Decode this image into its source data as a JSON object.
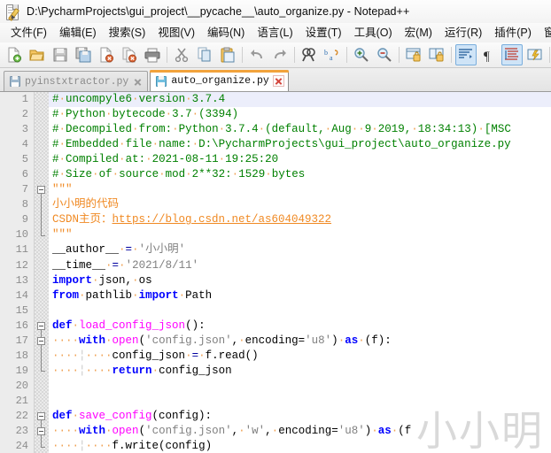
{
  "window": {
    "title": "D:\\PycharmProjects\\gui_project\\__pycache__\\auto_organize.py - Notepad++",
    "app_icon": "notepad-plus-plus-icon"
  },
  "menubar": {
    "items": [
      {
        "label": "文件(F)",
        "name": "menu-file"
      },
      {
        "label": "编辑(E)",
        "name": "menu-edit"
      },
      {
        "label": "搜索(S)",
        "name": "menu-search"
      },
      {
        "label": "视图(V)",
        "name": "menu-view"
      },
      {
        "label": "编码(N)",
        "name": "menu-encoding"
      },
      {
        "label": "语言(L)",
        "name": "menu-language"
      },
      {
        "label": "设置(T)",
        "name": "menu-settings"
      },
      {
        "label": "工具(O)",
        "name": "menu-tools"
      },
      {
        "label": "宏(M)",
        "name": "menu-macro"
      },
      {
        "label": "运行(R)",
        "name": "menu-run"
      },
      {
        "label": "插件(P)",
        "name": "menu-plugins"
      },
      {
        "label": "窗口(W",
        "name": "menu-window"
      }
    ]
  },
  "toolbar": {
    "buttons": [
      {
        "icon": "new-file-icon",
        "active": false
      },
      {
        "icon": "open-file-icon",
        "active": false
      },
      {
        "icon": "save-icon",
        "active": false
      },
      {
        "icon": "save-all-icon",
        "active": false
      },
      {
        "icon": "close-file-icon",
        "active": false
      },
      {
        "icon": "close-all-files-icon",
        "active": false
      },
      {
        "icon": "print-icon",
        "active": false
      },
      {
        "sep": true
      },
      {
        "icon": "cut-icon",
        "active": false
      },
      {
        "icon": "copy-icon",
        "active": false
      },
      {
        "icon": "paste-icon",
        "active": false
      },
      {
        "sep": true
      },
      {
        "icon": "undo-icon",
        "active": false
      },
      {
        "icon": "redo-icon",
        "active": false
      },
      {
        "sep": true
      },
      {
        "icon": "find-icon",
        "active": false
      },
      {
        "icon": "replace-icon",
        "active": false
      },
      {
        "sep": true
      },
      {
        "icon": "zoom-in-icon",
        "active": false
      },
      {
        "icon": "zoom-out-icon",
        "active": false
      },
      {
        "sep": true
      },
      {
        "icon": "sync-vertical-scroll-icon",
        "active": false
      },
      {
        "icon": "sync-horizontal-scroll-icon",
        "active": false
      },
      {
        "sep": true
      },
      {
        "icon": "word-wrap-icon",
        "active": true
      },
      {
        "icon": "show-all-characters-icon",
        "active": false
      },
      {
        "icon": "indent-guide-icon",
        "active": true
      },
      {
        "icon": "user-defined-language-icon",
        "active": false
      },
      {
        "sep2": true
      },
      {
        "icon": "document-map-icon",
        "active": false
      },
      {
        "icon": "function-list-icon",
        "active": false
      },
      {
        "icon": "folder-as-workspace-icon",
        "active": false
      }
    ]
  },
  "tabs": [
    {
      "label": "pyinstxtractor.py",
      "active": false,
      "name": "tab-pyinstxtractor"
    },
    {
      "label": "auto_organize.py",
      "active": true,
      "name": "tab-auto-organize"
    }
  ],
  "editor": {
    "current_line": 1,
    "watermark": "小小明",
    "line_numbers": [
      1,
      2,
      3,
      4,
      5,
      6,
      7,
      8,
      9,
      10,
      11,
      12,
      13,
      14,
      15,
      16,
      17,
      18,
      19,
      20,
      21,
      22,
      23,
      24
    ],
    "lines": [
      {
        "n": 1,
        "tokens": [
          {
            "t": "# uncompyle6 version 3.7.4",
            "c": "c-com",
            "dots": true
          }
        ]
      },
      {
        "n": 2,
        "tokens": [
          {
            "t": "# Python bytecode 3.7 (3394)",
            "c": "c-com",
            "dots": true
          }
        ]
      },
      {
        "n": 3,
        "tokens": [
          {
            "t": "# Decompiled from: Python 3.7.4 (default, Aug  9 2019, 18:34:13) [MSC",
            "c": "c-com",
            "dots": true
          }
        ]
      },
      {
        "n": 4,
        "tokens": [
          {
            "t": "# Embedded file name: D:\\PycharmProjects\\gui_project\\auto_organize.py",
            "c": "c-com",
            "dots": true
          }
        ]
      },
      {
        "n": 5,
        "tokens": [
          {
            "t": "# Compiled at: 2021-08-11 19:25:20",
            "c": "c-com",
            "dots": true
          }
        ]
      },
      {
        "n": 6,
        "tokens": [
          {
            "t": "# Size of source mod 2**32: 1529 bytes",
            "c": "c-com",
            "dots": true
          }
        ]
      },
      {
        "n": 7,
        "tokens": [
          {
            "t": "\"\"\"",
            "c": "c-doc"
          }
        ]
      },
      {
        "n": 8,
        "tokens": [
          {
            "t": "小小明的代码",
            "c": "c-doc"
          }
        ]
      },
      {
        "n": 9,
        "tokens": [
          {
            "t": "CSDN主页：",
            "c": "c-doc"
          },
          {
            "t": "https://blog.csdn.net/as604049322",
            "c": "c-link"
          }
        ]
      },
      {
        "n": 10,
        "tokens": [
          {
            "t": "\"\"\"",
            "c": "c-doc"
          }
        ]
      },
      {
        "n": 11,
        "tokens": [
          {
            "t": "__author__",
            "c": "c-pln"
          },
          {
            "t": " = ",
            "c": "c-op",
            "dots": true
          },
          {
            "t": "'小小明'",
            "c": "c-str"
          }
        ]
      },
      {
        "n": 12,
        "tokens": [
          {
            "t": "__time__",
            "c": "c-pln"
          },
          {
            "t": " = ",
            "c": "c-op",
            "dots": true
          },
          {
            "t": "'2021/8/11'",
            "c": "c-str"
          }
        ]
      },
      {
        "n": 13,
        "tokens": [
          {
            "t": "import",
            "c": "c-kw"
          },
          {
            "t": " json, os",
            "c": "c-pln",
            "dots": true
          }
        ]
      },
      {
        "n": 14,
        "tokens": [
          {
            "t": "from",
            "c": "c-kw"
          },
          {
            "t": " pathlib ",
            "c": "c-pln",
            "dots": true
          },
          {
            "t": "import",
            "c": "c-kw"
          },
          {
            "t": " Path",
            "c": "c-pln",
            "dots": true
          }
        ]
      },
      {
        "n": 15,
        "tokens": []
      },
      {
        "n": 16,
        "tokens": [
          {
            "t": "def",
            "c": "c-kw"
          },
          {
            "t": " ",
            "c": "c-pln",
            "dots": true
          },
          {
            "t": "load_config_json",
            "c": "c-fn"
          },
          {
            "t": "():",
            "c": "c-pln"
          }
        ]
      },
      {
        "n": 17,
        "indent": 1,
        "tokens": [
          {
            "t": "with",
            "c": "c-kw"
          },
          {
            "t": " ",
            "c": "c-pln",
            "dots": true
          },
          {
            "t": "open",
            "c": "c-fn"
          },
          {
            "t": "(",
            "c": "c-pln"
          },
          {
            "t": "'config.json'",
            "c": "c-str"
          },
          {
            "t": ", ",
            "c": "c-pln",
            "dots": true
          },
          {
            "t": "encoding=",
            "c": "c-pln"
          },
          {
            "t": "'u8'",
            "c": "c-str"
          },
          {
            "t": ") ",
            "c": "c-pln",
            "dots": true
          },
          {
            "t": "as",
            "c": "c-kw"
          },
          {
            "t": " ",
            "c": "c-pln",
            "dots": true
          },
          {
            "t": "(f):",
            "c": "c-pln"
          }
        ]
      },
      {
        "n": 18,
        "indent": 2,
        "tokens": [
          {
            "t": "config_json ",
            "c": "c-pln",
            "dots": true
          },
          {
            "t": "= ",
            "c": "c-op",
            "dots": true
          },
          {
            "t": "f.read()",
            "c": "c-pln"
          }
        ]
      },
      {
        "n": 19,
        "indent": 2,
        "tokens": [
          {
            "t": "return",
            "c": "c-kw"
          },
          {
            "t": " config_json",
            "c": "c-pln",
            "dots": true
          }
        ]
      },
      {
        "n": 20,
        "tokens": []
      },
      {
        "n": 21,
        "tokens": []
      },
      {
        "n": 22,
        "tokens": [
          {
            "t": "def",
            "c": "c-kw"
          },
          {
            "t": " ",
            "c": "c-pln",
            "dots": true
          },
          {
            "t": "save_config",
            "c": "c-fn"
          },
          {
            "t": "(config):",
            "c": "c-pln"
          }
        ]
      },
      {
        "n": 23,
        "indent": 1,
        "tokens": [
          {
            "t": "with",
            "c": "c-kw"
          },
          {
            "t": " ",
            "c": "c-pln",
            "dots": true
          },
          {
            "t": "open",
            "c": "c-fn"
          },
          {
            "t": "(",
            "c": "c-pln"
          },
          {
            "t": "'config.json'",
            "c": "c-str"
          },
          {
            "t": ", ",
            "c": "c-pln",
            "dots": true
          },
          {
            "t": "'w'",
            "c": "c-str"
          },
          {
            "t": ", ",
            "c": "c-pln",
            "dots": true
          },
          {
            "t": "encoding=",
            "c": "c-pln"
          },
          {
            "t": "'u8'",
            "c": "c-str"
          },
          {
            "t": ") ",
            "c": "c-pln",
            "dots": true
          },
          {
            "t": "as",
            "c": "c-kw"
          },
          {
            "t": " ",
            "c": "c-pln",
            "dots": true
          },
          {
            "t": "(f",
            "c": "c-pln"
          }
        ]
      },
      {
        "n": 24,
        "indent": 2,
        "tokens": [
          {
            "t": "f.write(config)",
            "c": "c-pln"
          }
        ]
      }
    ],
    "fold_points": [
      7,
      16,
      17,
      22,
      23
    ]
  },
  "colors": {
    "accent_tab": "#f2a33c",
    "comment": "#008000",
    "docstring": "#f08a24",
    "keyword": "#0000ff",
    "function": "#ff00ff",
    "string": "#808080",
    "current_line": "#eceefb"
  }
}
